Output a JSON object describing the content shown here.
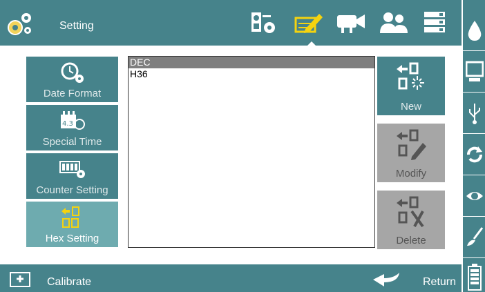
{
  "header": {
    "title": "Setting",
    "icons": [
      "settings-gears-icon",
      "device-settings-icon",
      "edit-tab-icon",
      "camera-icon",
      "users-icon",
      "server-icon"
    ]
  },
  "right_sidebar": {
    "icons": [
      "ink-drop-icon",
      "monitor-icon",
      "usb-icon",
      "refresh-icon",
      "eye-icon",
      "brush-icon",
      "battery-icon"
    ]
  },
  "left_menu": {
    "items": [
      {
        "label": "Date Format",
        "icon": "clock-gear-icon",
        "active": false
      },
      {
        "label": "Special Time",
        "icon": "calendar-clock-icon",
        "active": false
      },
      {
        "label": "Counter Setting",
        "icon": "counter-gear-icon",
        "active": false
      },
      {
        "label": "Hex Setting",
        "icon": "hex-convert-icon",
        "active": true
      }
    ]
  },
  "list": {
    "items": [
      "DEC",
      "H36"
    ],
    "selected_index": 0
  },
  "actions": {
    "new_label": "New",
    "modify_label": "Modify",
    "delete_label": "Delete"
  },
  "footer": {
    "calibrate_label": "Calibrate",
    "return_label": "Return"
  },
  "colors": {
    "teal": "#46838b",
    "active_teal": "#6eabaf",
    "disabled_gray": "#a6a6a6",
    "accent_yellow": "#f5d30f",
    "selected_row": "#7f7f7f"
  }
}
